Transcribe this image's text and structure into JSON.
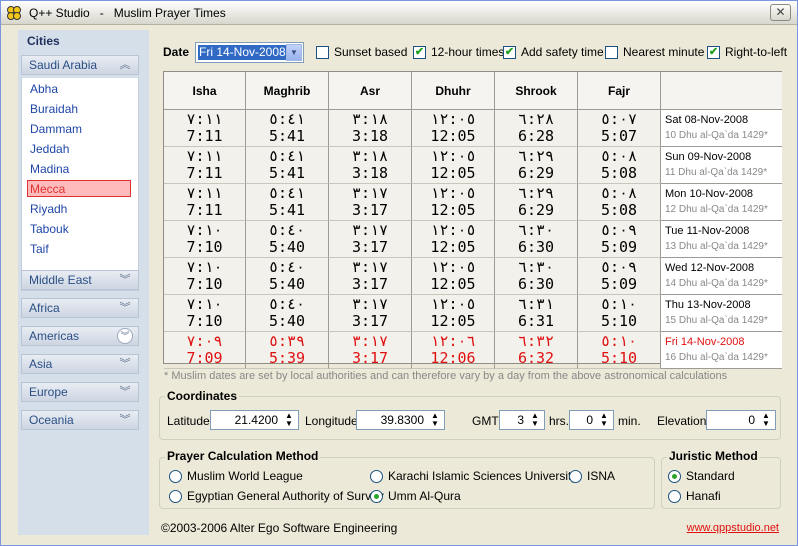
{
  "window": {
    "title": "Q++ Studio   -   Muslim Prayer Times",
    "close_glyph": "✕"
  },
  "sidebar": {
    "heading": "Cities",
    "active_group": "Saudi Arabia",
    "cities": [
      "Abha",
      "Buraidah",
      "Dammam",
      "Jeddah",
      "Madina",
      "Mecca",
      "Riyadh",
      "Tabouk",
      "Taif"
    ],
    "selected_city": "Mecca",
    "groups": [
      "Middle East",
      "Africa",
      "Americas",
      "Asia",
      "Europe",
      "Oceania"
    ]
  },
  "toolbar": {
    "date_label": "Date",
    "date_value": "Fri 14-Nov-2008",
    "options": [
      {
        "label": "Sunset based",
        "checked": false
      },
      {
        "label": "12-hour times",
        "checked": true
      },
      {
        "label": "Add safety time",
        "checked": true
      },
      {
        "label": "Nearest minute",
        "checked": false
      },
      {
        "label": "Right-to-left",
        "checked": true
      }
    ]
  },
  "table": {
    "headers": [
      "Isha",
      "Maghrib",
      "Asr",
      "Dhuhr",
      "Shrook",
      "Fajr"
    ],
    "rows": [
      {
        "date": "Sat 08-Nov-2008",
        "hijri": "10 Dhu al-Qa`da 1429*",
        "times": [
          "7:11",
          "5:41",
          "3:18",
          "12:05",
          "6:28",
          "5:07"
        ],
        "arabic": [
          "٧:١١",
          "٥:٤١",
          "٣:١٨",
          "١٢:٠٥",
          "٦:٢٨",
          "٥:٠٧"
        ],
        "today": false
      },
      {
        "date": "Sun 09-Nov-2008",
        "hijri": "11 Dhu al-Qa`da 1429*",
        "times": [
          "7:11",
          "5:41",
          "3:18",
          "12:05",
          "6:29",
          "5:08"
        ],
        "arabic": [
          "٧:١١",
          "٥:٤١",
          "٣:١٨",
          "١٢:٠٥",
          "٦:٢٩",
          "٥:٠٨"
        ],
        "today": false
      },
      {
        "date": "Mon 10-Nov-2008",
        "hijri": "12 Dhu al-Qa`da 1429*",
        "times": [
          "7:11",
          "5:41",
          "3:17",
          "12:05",
          "6:29",
          "5:08"
        ],
        "arabic": [
          "٧:١١",
          "٥:٤١",
          "٣:١٧",
          "١٢:٠٥",
          "٦:٢٩",
          "٥:٠٨"
        ],
        "today": false
      },
      {
        "date": "Tue 11-Nov-2008",
        "hijri": "13 Dhu al-Qa`da 1429*",
        "times": [
          "7:10",
          "5:40",
          "3:17",
          "12:05",
          "6:30",
          "5:09"
        ],
        "arabic": [
          "٧:١٠",
          "٥:٤٠",
          "٣:١٧",
          "١٢:٠٥",
          "٦:٣٠",
          "٥:٠٩"
        ],
        "today": false
      },
      {
        "date": "Wed 12-Nov-2008",
        "hijri": "14 Dhu al-Qa`da 1429*",
        "times": [
          "7:10",
          "5:40",
          "3:17",
          "12:05",
          "6:30",
          "5:09"
        ],
        "arabic": [
          "٧:١٠",
          "٥:٤٠",
          "٣:١٧",
          "١٢:٠٥",
          "٦:٣٠",
          "٥:٠٩"
        ],
        "today": false
      },
      {
        "date": "Thu 13-Nov-2008",
        "hijri": "15 Dhu al-Qa`da 1429*",
        "times": [
          "7:10",
          "5:40",
          "3:17",
          "12:05",
          "6:31",
          "5:10"
        ],
        "arabic": [
          "٧:١٠",
          "٥:٤٠",
          "٣:١٧",
          "١٢:٠٥",
          "٦:٣١",
          "٥:١٠"
        ],
        "today": false
      },
      {
        "date": "Fri 14-Nov-2008",
        "hijri": "16 Dhu al-Qa`da 1429*",
        "times": [
          "7:09",
          "5:39",
          "3:17",
          "12:06",
          "6:32",
          "5:10"
        ],
        "arabic": [
          "٧:٠٩",
          "٥:٣٩",
          "٣:١٧",
          "١٢:٠٦",
          "٦:٣٢",
          "٥:١٠"
        ],
        "today": true
      }
    ]
  },
  "note": "* Muslim dates are set by local authorities and can therefore vary by a day from the above astronomical calculations",
  "coordinates": {
    "title": "Coordinates",
    "latitude_label": "Latitude",
    "latitude": "21.4200",
    "longitude_label": "Longitude",
    "longitude": "39.8300",
    "gmt_label": "GMT",
    "gmt": "3",
    "hrs_label": "hrs.",
    "min": "0",
    "min_label": "min.",
    "elevation_label": "Elevation",
    "elevation": "0"
  },
  "method": {
    "title": "Prayer Calculation Method",
    "options": [
      "Muslim World League",
      "Egyptian General Authority of Survey",
      "Karachi Islamic Sciences University",
      "Umm Al-Qura",
      "ISNA"
    ],
    "selected": "Umm Al-Qura"
  },
  "juristic": {
    "title": "Juristic Method",
    "options": [
      "Standard",
      "Hanafi"
    ],
    "selected": "Standard"
  },
  "footer": {
    "copyright": "©2003-2006 Alter Ego Software Engineering",
    "link": "www.qppstudio.net"
  },
  "colors": {
    "accent": "#316ac5",
    "today": "#e01010",
    "link": "#e01010"
  }
}
